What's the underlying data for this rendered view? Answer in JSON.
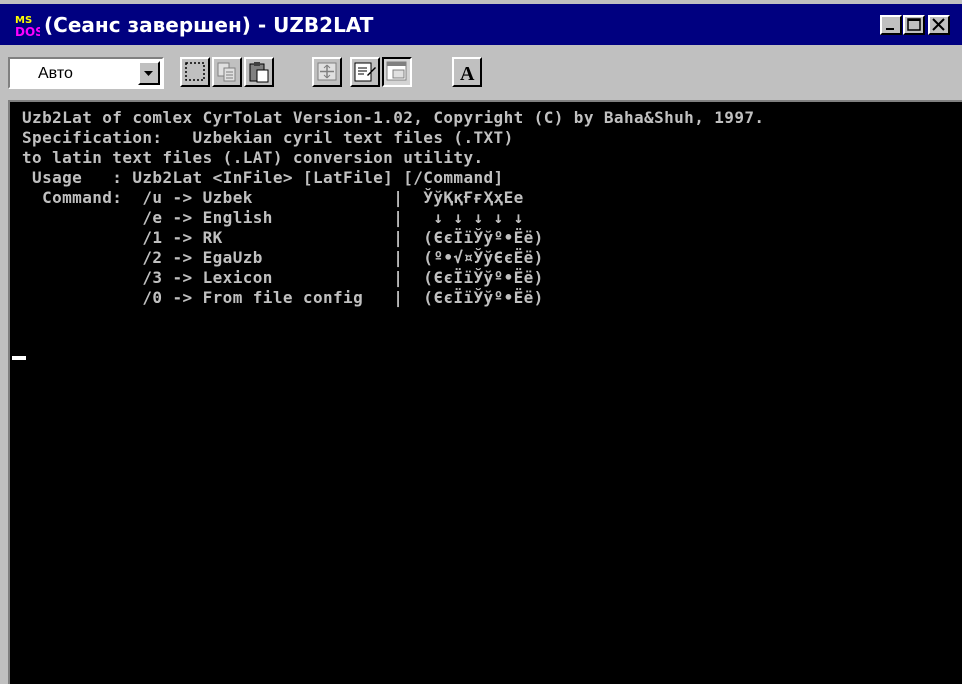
{
  "window": {
    "title": "(Сеанс завершен) - UZB2LAT",
    "icon": "ms-dos-icon",
    "controls": [
      "minimize-icon",
      "maximize-icon",
      "close-icon"
    ]
  },
  "toolbar": {
    "font_size_value": "Авто",
    "tools": [
      {
        "name": "mark-button",
        "icon": "mark-icon"
      },
      {
        "name": "copy-button",
        "icon": "copy-icon"
      },
      {
        "name": "paste-button",
        "icon": "paste-icon"
      },
      {
        "name": "fullscreen-button",
        "icon": "fullscreen-icon"
      },
      {
        "name": "properties-button",
        "icon": "properties-icon"
      },
      {
        "name": "background-button",
        "icon": "background-icon"
      },
      {
        "name": "font-button",
        "icon": "font-icon",
        "label": "A"
      }
    ]
  },
  "console": {
    "lines": [
      "Uzb2Lat of comlex CyrToLat Version-1.02, Copyright (C) by Baha&Shuh, 1997.",
      "Specification:   Uzbekian cyril text files (.TXT)",
      "to latin text files (.LAT) conversion utility.",
      " Usage   : Uzb2Lat <InFile> [LatFile] [/Command]",
      "  Command:  /u -> Uzbek              |  ЎўҚқҒғҲҳЕе",
      "            /e -> English            |   ↓ ↓ ↓ ↓ ↓",
      "            /1 -> RK                 |  (ЄєЇїЎўº•Ёё)",
      "            /2 -> EgaUzb             |  (º•√¤ЎўЄєЁё)",
      "            /3 -> Lexicon            |  (ЄєЇїЎўº•Ёё)",
      "            /0 -> From file config   |  (ЄєЇїЎўº•Ёё)"
    ]
  }
}
